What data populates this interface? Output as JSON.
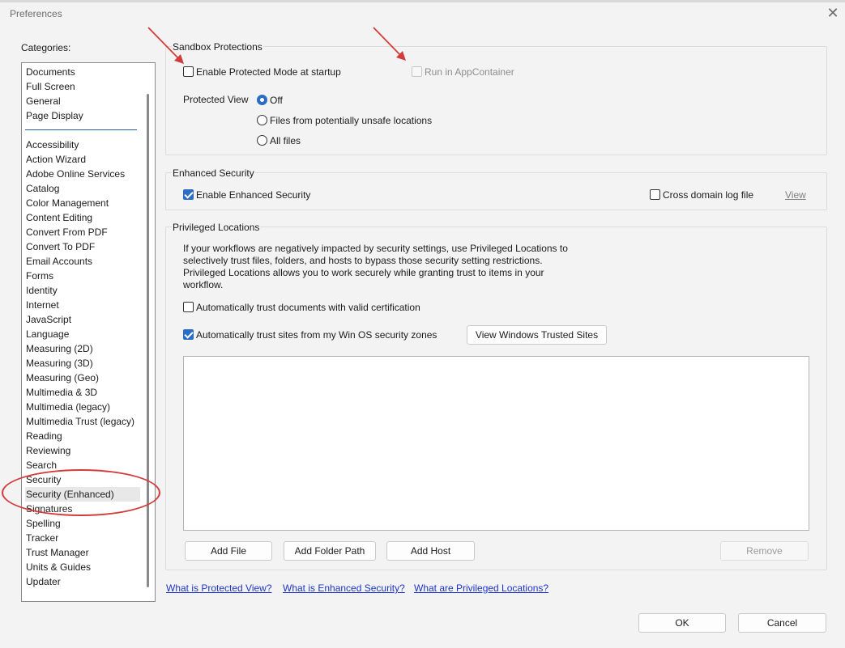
{
  "window": {
    "title": "Preferences",
    "close_glyph": "✕"
  },
  "categories": {
    "label": "Categories:",
    "top_items": [
      "Documents",
      "Full Screen",
      "General",
      "Page Display"
    ],
    "items": [
      "Accessibility",
      "Action Wizard",
      "Adobe Online Services",
      "Catalog",
      "Color Management",
      "Content Editing",
      "Convert From PDF",
      "Convert To PDF",
      "Email Accounts",
      "Forms",
      "Identity",
      "Internet",
      "JavaScript",
      "Language",
      "Measuring (2D)",
      "Measuring (3D)",
      "Measuring (Geo)",
      "Multimedia & 3D",
      "Multimedia (legacy)",
      "Multimedia Trust (legacy)",
      "Reading",
      "Reviewing",
      "Search",
      "Security",
      "Security (Enhanced)",
      "Signatures",
      "Spelling",
      "Tracker",
      "Trust Manager",
      "Units & Guides",
      "Updater"
    ],
    "selected": "Security (Enhanced)"
  },
  "sandbox": {
    "title": "Sandbox Protections",
    "protected_mode_label": "Enable Protected Mode at startup",
    "protected_mode_checked": false,
    "appcontainer_label": "Run in AppContainer",
    "appcontainer_checked": false,
    "appcontainer_disabled": true,
    "protected_view_label": "Protected View",
    "protected_view_options": [
      "Off",
      "Files from potentially unsafe locations",
      "All files"
    ],
    "protected_view_selected": "Off"
  },
  "enhanced": {
    "title": "Enhanced Security",
    "enable_label": "Enable Enhanced Security",
    "enable_checked": true,
    "cross_domain_label": "Cross domain log file",
    "cross_domain_checked": false,
    "view_link": "View"
  },
  "privileged": {
    "title": "Privileged Locations",
    "description_lines": [
      "If your workflows are negatively impacted by security settings, use Privileged Locations to",
      "selectively trust files, folders, and hosts to bypass those security setting restrictions.",
      "Privileged Locations allows you to work securely while granting trust to items in your",
      "workflow."
    ],
    "auto_trust_cert_label": "Automatically trust documents with valid certification",
    "auto_trust_cert_checked": false,
    "auto_trust_sites_label": "Automatically trust sites from my Win OS security zones",
    "auto_trust_sites_checked": true,
    "view_trusted_sites_button": "View Windows Trusted Sites",
    "add_file_button": "Add File",
    "add_folder_button": "Add Folder Path",
    "add_host_button": "Add Host",
    "remove_button": "Remove"
  },
  "help_links": {
    "protected_view": "What is Protected View?",
    "enhanced_security": "What is Enhanced Security?",
    "privileged_locations": "What are Privileged Locations?"
  },
  "footer": {
    "ok": "OK",
    "cancel": "Cancel"
  },
  "annotation_color": "#d33c3c",
  "accent_color": "#2b6cc4"
}
